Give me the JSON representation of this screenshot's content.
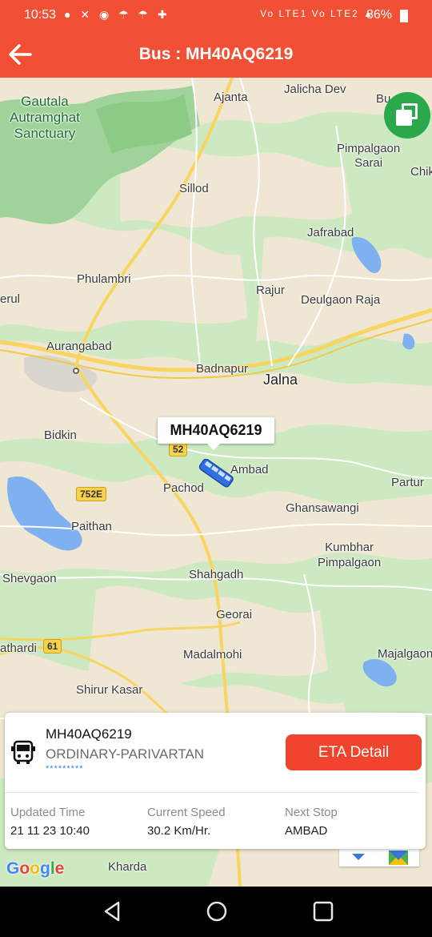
{
  "status_bar": {
    "time": "10:53",
    "battery": "86%",
    "network_lte1": "Vo LTE1",
    "network_lte2": "Vo LTE2"
  },
  "app_bar": {
    "title": "Bus : MH40AQ6219"
  },
  "map": {
    "places": {
      "gautala": "Gautala\nAutramghat\nSanctuary",
      "ajanta": "Ajanta",
      "jalicha_dev": "Jalicha Dev",
      "bu": "Bu",
      "pimpalgaon_sarai": "Pimpalgaon\nSarai",
      "chik": "Chik",
      "sillod": "Sillod",
      "jafrabad": "Jafrabad",
      "phulambri": "Phulambri",
      "rajur": "Rajur",
      "deulgaon_raja": "Deulgaon Raja",
      "erul": "erul",
      "aurangabad": "Aurangabad",
      "badnapur": "Badnapur",
      "jalna": "Jalna",
      "bidkin": "Bidkin",
      "ambad": "Ambad",
      "partur": "Partur",
      "pachod": "Pachod",
      "ghansawangi": "Ghansawangi",
      "paithan": "Paithan",
      "kumbhar_pimpalgaon": "Kumbhar\nPimpalgaon",
      "shevgaon": "Shevgaon",
      "shahgadh": "Shahgadh",
      "georai": "Georai",
      "athardi": "athardi",
      "madalmohi": "Madalmohi",
      "majalgaon": "Majalgaon",
      "shirur_kasar": "Shirur Kasar",
      "kharda": "Kharda"
    },
    "road_shields": {
      "r52": "52",
      "r752e": "752E",
      "r61": "61"
    },
    "bus_label": "MH40AQ6219",
    "google_logo": "Google"
  },
  "info_card": {
    "registration": "MH40AQ6219",
    "service_type": "ORDINARY-PARIVARTAN",
    "masked_text": "*********",
    "eta_button": "ETA Detail",
    "updated_time_label": "Updated Time",
    "updated_time_value": "21 11 23 10:40",
    "speed_label": "Current Speed",
    "speed_value": "30.2 Km/Hr.",
    "next_stop_label": "Next Stop",
    "next_stop_value": "AMBAD"
  },
  "colors": {
    "primary": "#f25034",
    "button": "#f0442c",
    "layers_button": "#2aa84a",
    "bus_marker": "#2f6fe0"
  }
}
